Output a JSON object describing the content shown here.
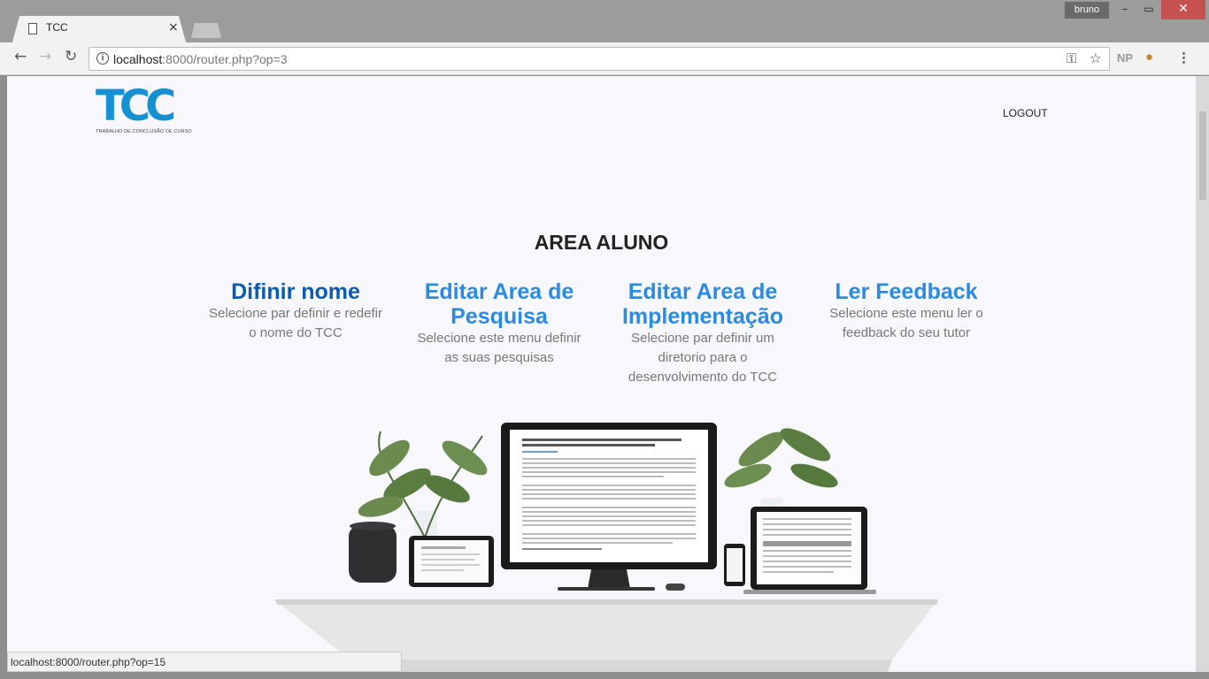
{
  "browser": {
    "tab_title": "TCC",
    "tab_close": "×",
    "user": "bruno",
    "window_controls": {
      "minimize": "–",
      "maximize": "▭",
      "close": "✕"
    },
    "url_host": "localhost",
    "url_rest": ":8000/router.php?op=3",
    "extension_label": "NP",
    "status_url": "localhost:8000/router.php?op=15"
  },
  "header": {
    "logo_text": "TCC",
    "logo_subtitle": "TRABALHO DE CONCLUSÃO DE CURSO",
    "logout_label": "LOGOUT"
  },
  "main": {
    "heading": "AREA ALUNO",
    "cards": [
      {
        "title": "Difinir nome",
        "description": "Selecione par definir e redefir o nome do TCC"
      },
      {
        "title": "Editar Area de Pesquisa",
        "description": "Selecione este menu definir as suas pesquisas"
      },
      {
        "title": "Editar Area de Implementação",
        "description": "Selecione par definir um diretorio para o desenvolvimento do TCC"
      },
      {
        "title": "Ler Feedback",
        "description": "Selecione este menu ler o feedback do seu tutor"
      }
    ]
  },
  "colors": {
    "logo_blue": "#1590d3",
    "card_primary": "#0b5cae",
    "card_link": "#2b8be0"
  },
  "icons": [
    "page-icon",
    "back-icon",
    "forward-icon",
    "reload-icon",
    "info-icon",
    "key-icon",
    "star-icon",
    "cookie-icon",
    "menu-icon"
  ]
}
